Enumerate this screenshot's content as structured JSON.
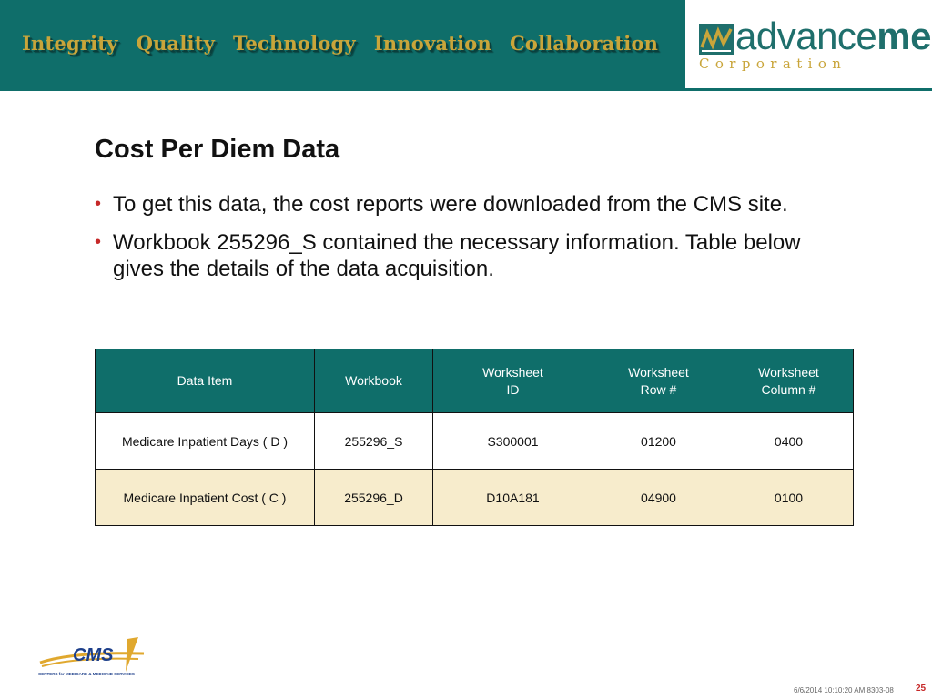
{
  "header": {
    "values": [
      "Integrity",
      "Quality",
      "Technology",
      "Innovation",
      "Collaboration"
    ]
  },
  "logo": {
    "word_part1": "advance",
    "word_part2": "med",
    "subtitle": "Corporation"
  },
  "slide": {
    "title": "Cost Per Diem Data",
    "bullets": [
      "To get this data, the cost reports were downloaded from the CMS site.",
      "Workbook 255296_S contained the necessary information. Table below gives the details of the data acquisition."
    ]
  },
  "table": {
    "columns": [
      "Data Item",
      "Workbook",
      "Worksheet\nID",
      "Worksheet\nRow #",
      "Worksheet\nColumn #"
    ],
    "rows": [
      [
        "Medicare Inpatient Days ( D )",
        "255296_S",
        "S300001",
        "01200",
        "0400"
      ],
      [
        "Medicare Inpatient Cost ( C )",
        "255296_D",
        "D10A181",
        "04900",
        "0100"
      ]
    ]
  },
  "cms_logo": {
    "text": "CMS",
    "caption": "CENTERS for MEDICARE & MEDICAID SERVICES"
  },
  "footer": {
    "date": "6/6/2014 10:10:20 AM 8303-08",
    "page": "25"
  },
  "colors": {
    "teal": "#0f6e6a",
    "gold": "#c9a53a",
    "bullet_red": "#c62828",
    "row_highlight": "#f7eccc"
  }
}
